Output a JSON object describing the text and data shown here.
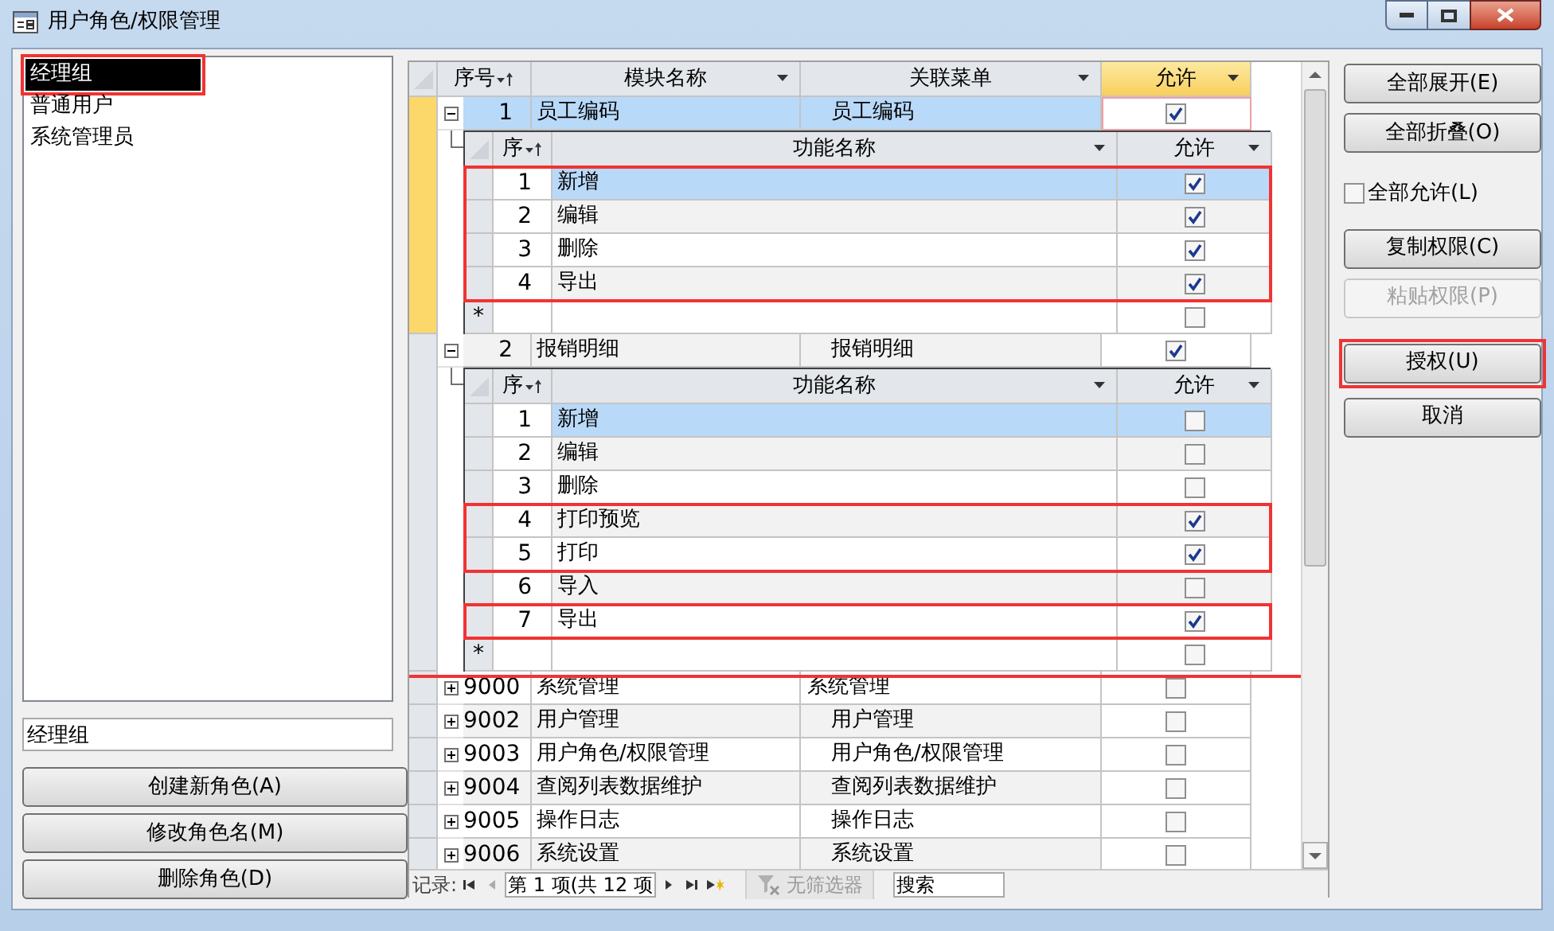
{
  "window": {
    "title": "用户角色/权限管理"
  },
  "roles": [
    {
      "label": "经理组",
      "selected": true,
      "highlighted": true
    },
    {
      "label": "普通用户",
      "selected": false,
      "highlighted": false
    },
    {
      "label": "系统管理员",
      "selected": false,
      "highlighted": false
    }
  ],
  "role_name_field": {
    "value": "经理组"
  },
  "left_buttons": [
    {
      "label": "创建新角色(A)"
    },
    {
      "label": "修改角色名(M)"
    },
    {
      "label": "删除角色(D)"
    }
  ],
  "table": {
    "highlighted": true,
    "columns": [
      {
        "label": "序号",
        "sorted": true,
        "selected": false
      },
      {
        "label": "模块名称",
        "sorted": false,
        "selected": false
      },
      {
        "label": "关联菜单",
        "sorted": false,
        "selected": false
      },
      {
        "label": "允许",
        "sorted": false,
        "selected": true
      }
    ],
    "rows": [
      {
        "no": "1",
        "module": "员工编码",
        "menu": "员工编码",
        "indented": true,
        "allowed": true,
        "selected": true,
        "expanded": true,
        "sub_columns": [
          {
            "label": "序",
            "sorted": true
          },
          {
            "label": "功能名称",
            "sorted": false
          },
          {
            "label": "允许",
            "sorted": false
          }
        ],
        "children": [
          {
            "no": "1",
            "name": "新增",
            "allowed": true,
            "selected": true,
            "highlighted": true
          },
          {
            "no": "2",
            "name": "编辑",
            "allowed": true,
            "selected": false,
            "highlighted": true
          },
          {
            "no": "3",
            "name": "删除",
            "allowed": true,
            "selected": false,
            "highlighted": true
          },
          {
            "no": "4",
            "name": "导出",
            "allowed": true,
            "selected": false,
            "highlighted": true
          }
        ],
        "new_row_marker": "*"
      },
      {
        "no": "2",
        "module": "报销明细",
        "menu": "报销明细",
        "indented": true,
        "allowed": true,
        "selected": false,
        "expanded": true,
        "sub_columns": [
          {
            "label": "序",
            "sorted": true
          },
          {
            "label": "功能名称",
            "sorted": false
          },
          {
            "label": "允许",
            "sorted": false
          }
        ],
        "children": [
          {
            "no": "1",
            "name": "新增",
            "allowed": false,
            "selected": true,
            "highlighted": false
          },
          {
            "no": "2",
            "name": "编辑",
            "allowed": false,
            "selected": false,
            "highlighted": false
          },
          {
            "no": "3",
            "name": "删除",
            "allowed": false,
            "selected": false,
            "highlighted": false
          },
          {
            "no": "4",
            "name": "打印预览",
            "allowed": true,
            "selected": false,
            "highlighted": true
          },
          {
            "no": "5",
            "name": "打印",
            "allowed": true,
            "selected": false,
            "highlighted": true
          },
          {
            "no": "6",
            "name": "导入",
            "allowed": false,
            "selected": false,
            "highlighted": false
          },
          {
            "no": "7",
            "name": "导出",
            "allowed": true,
            "selected": false,
            "highlighted": true
          }
        ],
        "new_row_marker": "*"
      },
      {
        "no": "9000",
        "module": "系统管理",
        "menu": "系统管理",
        "indented": false,
        "allowed": false,
        "selected": false,
        "expanded": false
      },
      {
        "no": "9002",
        "module": "用户管理",
        "menu": "用户管理",
        "indented": true,
        "allowed": false,
        "selected": false,
        "expanded": false
      },
      {
        "no": "9003",
        "module": "用户角色/权限管理",
        "menu": "用户角色/权限管理",
        "indented": true,
        "allowed": false,
        "selected": false,
        "expanded": false
      },
      {
        "no": "9004",
        "module": "查阅列表数据维护",
        "menu": "查阅列表数据维护",
        "indented": true,
        "allowed": false,
        "selected": false,
        "expanded": false
      },
      {
        "no": "9005",
        "module": "操作日志",
        "menu": "操作日志",
        "indented": true,
        "allowed": false,
        "selected": false,
        "expanded": false
      },
      {
        "no": "9006",
        "module": "系统设置",
        "menu": "系统设置",
        "indented": true,
        "allowed": false,
        "selected": false,
        "expanded": false
      }
    ]
  },
  "navigator": {
    "label": "记录:",
    "position": "第 1 项(共 12 项",
    "filter": "无筛选器",
    "search": {
      "placeholder": "搜索"
    }
  },
  "right_buttons": [
    {
      "kind": "button",
      "label": "全部展开(E)",
      "disabled": false,
      "highlighted": false
    },
    {
      "kind": "button",
      "label": "全部折叠(O)",
      "disabled": false,
      "highlighted": false
    },
    {
      "kind": "checkbox",
      "label": "全部允许(L)",
      "checked": false
    },
    {
      "kind": "button",
      "label": "复制权限(C)",
      "disabled": false,
      "highlighted": false
    },
    {
      "kind": "button",
      "label": "粘贴权限(P)",
      "disabled": true,
      "highlighted": false
    },
    {
      "kind": "button",
      "label": "授权(U)",
      "disabled": false,
      "highlighted": true
    },
    {
      "kind": "button",
      "label": "取消",
      "disabled": false,
      "highlighted": false
    }
  ]
}
